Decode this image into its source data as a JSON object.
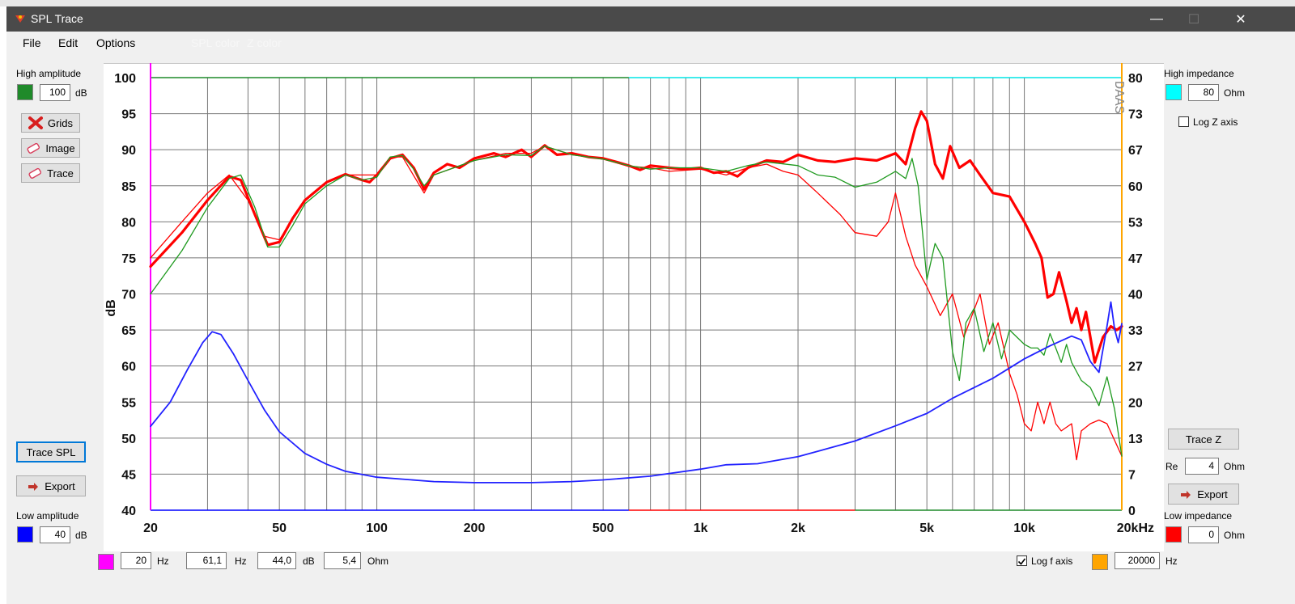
{
  "window": {
    "title": "SPL Trace",
    "minimize": "—",
    "maximize": "☐",
    "close": "✕"
  },
  "menu": {
    "file": "File",
    "edit": "Edit",
    "options": "Options",
    "spl_color": "SPL color",
    "z_color": "Z color"
  },
  "left": {
    "high_amplitude_label": "High amplitude",
    "high_amplitude_value": "100",
    "high_amplitude_unit": "dB",
    "high_color": "#1f8a2a",
    "grids_btn": "Grids",
    "image_btn": "Image",
    "trace_btn": "Trace",
    "trace_spl_btn": "Trace SPL",
    "export_btn": "Export",
    "low_amplitude_label": "Low amplitude",
    "low_amplitude_value": "40",
    "low_amplitude_unit": "dB",
    "low_color": "#0000ff"
  },
  "right": {
    "high_impedance_label": "High impedance",
    "high_impedance_value": "80",
    "high_impedance_unit": "Ohm",
    "high_color": "#00ffff",
    "log_z_label": "Log Z axis",
    "log_z_checked": false,
    "trace_z_btn": "Trace Z",
    "re_label": "Re",
    "re_value": "4",
    "re_unit": "Ohm",
    "export_btn": "Export",
    "low_impedance_label": "Low impedance",
    "low_impedance_value": "0",
    "low_impedance_unit": "Ohm",
    "low_color": "#ff0000"
  },
  "bottom": {
    "f_low_color": "#ff00ff",
    "f_low_value": "20",
    "f_low_unit": "Hz",
    "cursor_freq": "61,1",
    "cursor_freq_unit": "Hz",
    "cursor_db": "44,0",
    "cursor_db_unit": "dB",
    "cursor_ohm": "5,4",
    "cursor_ohm_unit": "Ohm",
    "log_f_label": "Log f axis",
    "log_f_checked": true,
    "f_high_color": "#ffa500",
    "f_high_value": "20000",
    "f_high_unit": "Hz"
  },
  "chart_data": {
    "type": "line",
    "ylabel": "dB",
    "ylim": [
      40,
      100
    ],
    "xlim": [
      20,
      20000
    ],
    "xscale": "log",
    "watermark": "DAAS",
    "y_ticks": [
      "100",
      "95",
      "90",
      "85",
      "80",
      "75",
      "70",
      "65",
      "60",
      "55",
      "50",
      "45",
      "40"
    ],
    "y2_ticks": [
      "80",
      "73",
      "67",
      "60",
      "53",
      "47",
      "40",
      "33",
      "27",
      "20",
      "13",
      "7",
      "0"
    ],
    "y2lim": [
      0,
      80
    ],
    "x_ticks": [
      {
        "v": 20,
        "label": "20"
      },
      {
        "v": 50,
        "label": "50"
      },
      {
        "v": 100,
        "label": "100"
      },
      {
        "v": 200,
        "label": "200"
      },
      {
        "v": 500,
        "label": "500"
      },
      {
        "v": 1000,
        "label": "1k"
      },
      {
        "v": 2000,
        "label": "2k"
      },
      {
        "v": 5000,
        "label": "5k"
      },
      {
        "v": 10000,
        "label": "10k"
      },
      {
        "v": 20000,
        "label": "20kHz"
      }
    ],
    "series": [
      {
        "color": "#ff0000",
        "width": 3.2,
        "axis": "spl",
        "points": [
          [
            20,
            73.8
          ],
          [
            25,
            78.5
          ],
          [
            30,
            83
          ],
          [
            35,
            86.3
          ],
          [
            38,
            85.8
          ],
          [
            42,
            81
          ],
          [
            46,
            76.8
          ],
          [
            50,
            77.2
          ],
          [
            55,
            80.5
          ],
          [
            60,
            83
          ],
          [
            70,
            85.5
          ],
          [
            80,
            86.6
          ],
          [
            90,
            85.8
          ],
          [
            95,
            85.5
          ],
          [
            100,
            86.5
          ],
          [
            110,
            88.8
          ],
          [
            120,
            89.3
          ],
          [
            130,
            87.5
          ],
          [
            140,
            84.5
          ],
          [
            150,
            86.8
          ],
          [
            165,
            88
          ],
          [
            180,
            87.5
          ],
          [
            200,
            88.8
          ],
          [
            230,
            89.5
          ],
          [
            250,
            89
          ],
          [
            280,
            90
          ],
          [
            300,
            89
          ],
          [
            330,
            90.6
          ],
          [
            360,
            89.3
          ],
          [
            400,
            89.5
          ],
          [
            450,
            89
          ],
          [
            500,
            88.8
          ],
          [
            550,
            88.3
          ],
          [
            600,
            87.8
          ],
          [
            650,
            87.2
          ],
          [
            700,
            87.8
          ],
          [
            800,
            87.5
          ],
          [
            900,
            87.3
          ],
          [
            1000,
            87.5
          ],
          [
            1100,
            86.8
          ],
          [
            1200,
            87
          ],
          [
            1300,
            86.3
          ],
          [
            1400,
            87.5
          ],
          [
            1600,
            88.5
          ],
          [
            1800,
            88.3
          ],
          [
            2000,
            89.3
          ],
          [
            2300,
            88.5
          ],
          [
            2600,
            88.3
          ],
          [
            3000,
            88.8
          ],
          [
            3500,
            88.5
          ],
          [
            4000,
            89.5
          ],
          [
            4300,
            88
          ],
          [
            4600,
            93
          ],
          [
            4800,
            95.3
          ],
          [
            5000,
            94
          ],
          [
            5300,
            88
          ],
          [
            5600,
            86
          ],
          [
            5900,
            90.5
          ],
          [
            6300,
            87.5
          ],
          [
            6800,
            88.5
          ],
          [
            7300,
            86.5
          ],
          [
            8000,
            84
          ],
          [
            9000,
            83.5
          ],
          [
            10000,
            80
          ],
          [
            10800,
            77
          ],
          [
            11300,
            75
          ],
          [
            11800,
            69.5
          ],
          [
            12300,
            70
          ],
          [
            12800,
            73
          ],
          [
            13500,
            69
          ],
          [
            14000,
            66
          ],
          [
            14500,
            68
          ],
          [
            15000,
            65
          ],
          [
            15500,
            67.5
          ],
          [
            16500,
            60.5
          ],
          [
            17500,
            64
          ],
          [
            18500,
            65.5
          ],
          [
            19300,
            65
          ],
          [
            20000,
            65.5
          ]
        ]
      },
      {
        "color": "#ff0000",
        "width": 1.3,
        "axis": "spl",
        "points": [
          [
            20,
            75
          ],
          [
            25,
            80
          ],
          [
            30,
            84
          ],
          [
            35,
            86.5
          ],
          [
            40,
            83
          ],
          [
            45,
            78
          ],
          [
            50,
            77.5
          ],
          [
            60,
            83
          ],
          [
            70,
            85.5
          ],
          [
            80,
            86.5
          ],
          [
            100,
            86.5
          ],
          [
            110,
            89
          ],
          [
            120,
            89
          ],
          [
            140,
            84
          ],
          [
            150,
            86.5
          ],
          [
            200,
            88.5
          ],
          [
            250,
            89.5
          ],
          [
            300,
            89.5
          ],
          [
            330,
            90.5
          ],
          [
            400,
            89.3
          ],
          [
            500,
            88.7
          ],
          [
            600,
            87.7
          ],
          [
            700,
            87.5
          ],
          [
            800,
            87
          ],
          [
            1000,
            87.3
          ],
          [
            1200,
            86.5
          ],
          [
            1400,
            87.5
          ],
          [
            1600,
            88
          ],
          [
            1800,
            87
          ],
          [
            2000,
            86.5
          ],
          [
            2300,
            84
          ],
          [
            2700,
            81
          ],
          [
            3000,
            78.5
          ],
          [
            3500,
            78
          ],
          [
            3800,
            80
          ],
          [
            4000,
            84
          ],
          [
            4300,
            78
          ],
          [
            4600,
            74
          ],
          [
            5000,
            71
          ],
          [
            5500,
            67
          ],
          [
            6000,
            70
          ],
          [
            6500,
            64
          ],
          [
            7300,
            70
          ],
          [
            7800,
            63
          ],
          [
            8300,
            66
          ],
          [
            9000,
            59
          ],
          [
            9500,
            56
          ],
          [
            10000,
            52
          ],
          [
            10500,
            51
          ],
          [
            11000,
            55
          ],
          [
            11500,
            52
          ],
          [
            12000,
            55
          ],
          [
            12500,
            52
          ],
          [
            13000,
            51
          ],
          [
            14000,
            52
          ],
          [
            14500,
            47
          ],
          [
            15000,
            51
          ],
          [
            16000,
            52
          ],
          [
            17000,
            52.5
          ],
          [
            18000,
            52
          ],
          [
            20000,
            47.5
          ]
        ]
      },
      {
        "color": "#1f9a1f",
        "width": 1.3,
        "axis": "spl",
        "points": [
          [
            20,
            70
          ],
          [
            25,
            76
          ],
          [
            30,
            82
          ],
          [
            35,
            86
          ],
          [
            38,
            86.5
          ],
          [
            42,
            82
          ],
          [
            46,
            76.5
          ],
          [
            50,
            76.5
          ],
          [
            55,
            79.5
          ],
          [
            60,
            82.5
          ],
          [
            70,
            85
          ],
          [
            80,
            86.5
          ],
          [
            90,
            85.8
          ],
          [
            100,
            86.2
          ],
          [
            110,
            89
          ],
          [
            120,
            89.2
          ],
          [
            130,
            87.3
          ],
          [
            140,
            85
          ],
          [
            150,
            86.5
          ],
          [
            200,
            88.5
          ],
          [
            250,
            89.3
          ],
          [
            300,
            89.2
          ],
          [
            330,
            90.5
          ],
          [
            400,
            89.3
          ],
          [
            500,
            88.7
          ],
          [
            600,
            87.8
          ],
          [
            700,
            87.3
          ],
          [
            800,
            87.5
          ],
          [
            1000,
            87.5
          ],
          [
            1200,
            87
          ],
          [
            1400,
            87.8
          ],
          [
            1600,
            88.3
          ],
          [
            2000,
            87.8
          ],
          [
            2300,
            86.5
          ],
          [
            2600,
            86.2
          ],
          [
            3000,
            84.8
          ],
          [
            3500,
            85.5
          ],
          [
            4000,
            87
          ],
          [
            4300,
            86
          ],
          [
            4500,
            88.8
          ],
          [
            4700,
            85
          ],
          [
            5000,
            72
          ],
          [
            5300,
            77
          ],
          [
            5600,
            75
          ],
          [
            6000,
            62
          ],
          [
            6300,
            58
          ],
          [
            6600,
            66
          ],
          [
            7000,
            68
          ],
          [
            7500,
            62
          ],
          [
            8000,
            66
          ],
          [
            8500,
            61
          ],
          [
            9000,
            65
          ],
          [
            10000,
            63
          ],
          [
            10500,
            62.5
          ],
          [
            11000,
            62.5
          ],
          [
            11500,
            61.5
          ],
          [
            12000,
            64.5
          ],
          [
            12500,
            62.5
          ],
          [
            13000,
            60.5
          ],
          [
            13500,
            63
          ],
          [
            14000,
            60.5
          ],
          [
            15000,
            58
          ],
          [
            16000,
            57
          ],
          [
            17000,
            54.5
          ],
          [
            18000,
            58.5
          ],
          [
            19000,
            54
          ],
          [
            20000,
            47.5
          ]
        ]
      },
      {
        "color": "#2222ff",
        "width": 1.8,
        "axis": "z",
        "points": [
          [
            20,
            15.5
          ],
          [
            23,
            20
          ],
          [
            26,
            26
          ],
          [
            29,
            31
          ],
          [
            31,
            33
          ],
          [
            33,
            32.5
          ],
          [
            36,
            29
          ],
          [
            40,
            24
          ],
          [
            45,
            18.5
          ],
          [
            50,
            14.5
          ],
          [
            60,
            10.5
          ],
          [
            70,
            8.5
          ],
          [
            80,
            7.2
          ],
          [
            100,
            6.1
          ],
          [
            150,
            5.3
          ],
          [
            200,
            5.1
          ],
          [
            300,
            5.1
          ],
          [
            400,
            5.3
          ],
          [
            500,
            5.6
          ],
          [
            700,
            6.3
          ],
          [
            1000,
            7.6
          ],
          [
            1200,
            8.4
          ],
          [
            1500,
            8.6
          ],
          [
            2000,
            9.9
          ],
          [
            3000,
            12.8
          ],
          [
            4000,
            15.6
          ],
          [
            5000,
            17.9
          ],
          [
            6000,
            20.7
          ],
          [
            8000,
            24.4
          ],
          [
            10000,
            28
          ],
          [
            12000,
            30.4
          ],
          [
            14000,
            32.2
          ],
          [
            15000,
            31.5
          ],
          [
            16000,
            27.5
          ],
          [
            17000,
            25.5
          ],
          [
            18000,
            34
          ],
          [
            18500,
            38.5
          ],
          [
            19000,
            33.5
          ],
          [
            19500,
            31
          ],
          [
            20000,
            34.5
          ]
        ]
      }
    ]
  }
}
